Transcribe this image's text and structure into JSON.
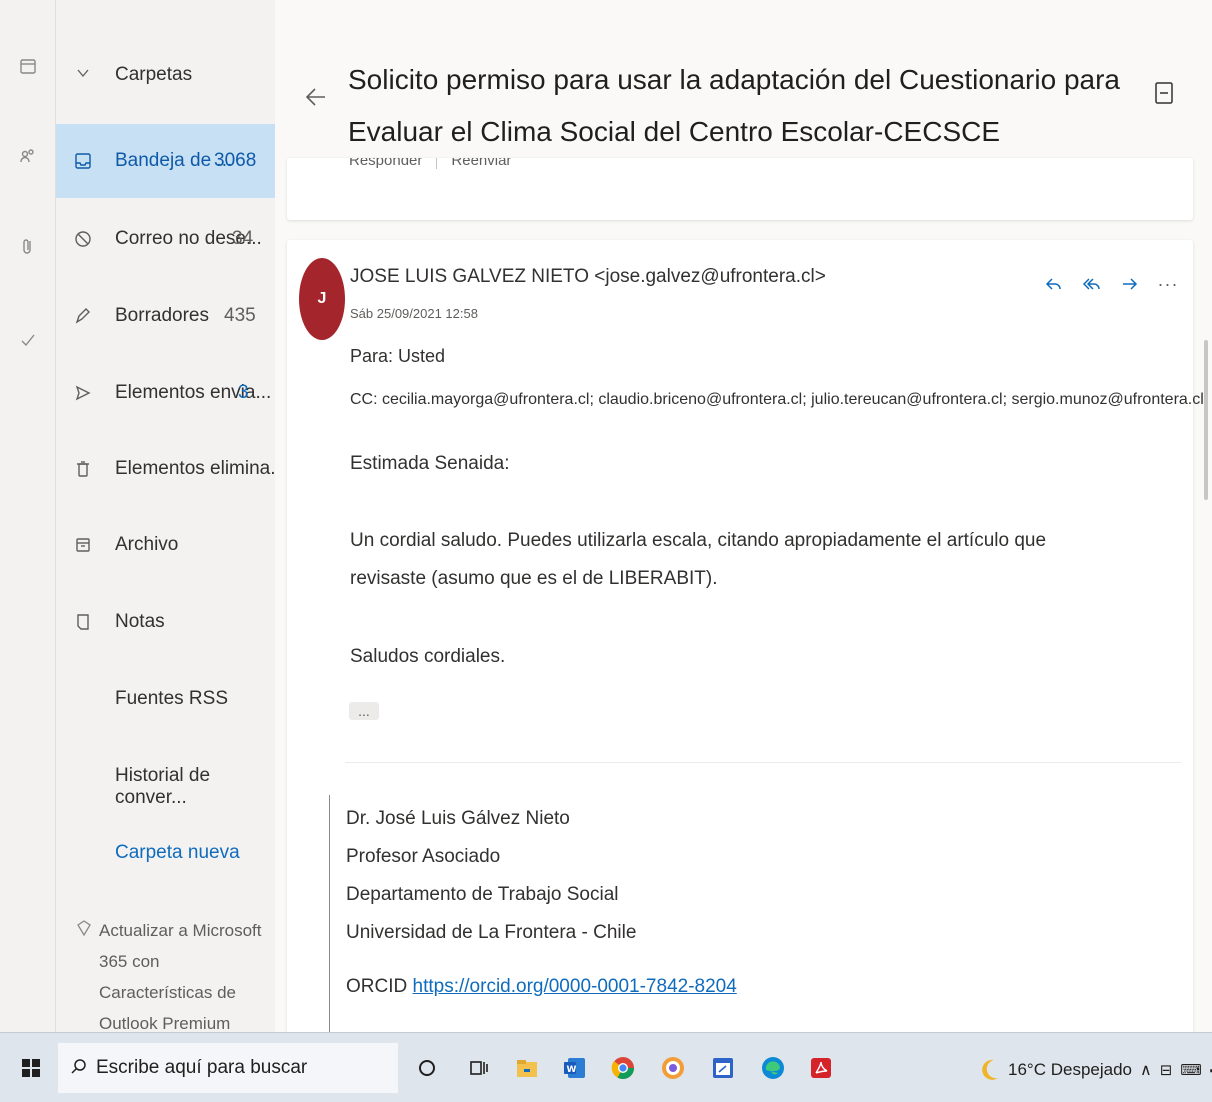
{
  "folders": {
    "header": "Carpetas",
    "items": [
      {
        "label": "Bandeja de ...",
        "count": "3068",
        "icon": "inbox-icon"
      },
      {
        "label": "Correo no dese...",
        "count": "34",
        "icon": "junk-icon"
      },
      {
        "label": "Borradores",
        "count": "435",
        "icon": "pencil-icon"
      },
      {
        "label": "Elementos envia...",
        "count": "3",
        "icon": "send-icon"
      },
      {
        "label": "Elementos elimina...",
        "count": "",
        "icon": "trash-icon"
      },
      {
        "label": "Archivo",
        "count": "",
        "icon": "archive-icon"
      },
      {
        "label": "Notas",
        "count": "",
        "icon": "note-icon"
      }
    ],
    "links": [
      "Fuentes RSS",
      "Historial de conver...",
      "Carpeta nueva"
    ],
    "upgrade": "Actualizar a Microsoft 365 con Características de Outlook Premium"
  },
  "message": {
    "subject": "Solicito permiso para usar la adaptación del Cuestionario para Evaluar el Clima Social del Centro Escolar-CECSCE",
    "prev_actions": [
      "Responder",
      "Reenviar"
    ],
    "avatar_initial": "J",
    "sender": "JOSE LUIS GALVEZ NIETO <jose.galvez@ufrontera.cl>",
    "date": "Sáb 25/09/2021 12:58",
    "to": "Para: Usted",
    "cc": "CC: cecilia.mayorga@ufrontera.cl; claudio.briceno@ufrontera.cl; julio.tereucan@ufrontera.cl; sergio.munoz@ufrontera.cl",
    "greeting": "Estimada Senaida:",
    "paragraph": "Un cordial saludo. Puedes utilizarla escala, citando apropiadamente el artículo que revisaste (asumo que es el de LIBERABIT).",
    "closing": "Saludos cordiales.",
    "ellipsis": "...",
    "signature": {
      "name": "Dr. José Luis Gálvez Nieto",
      "title": "Profesor Asociado",
      "department": "Departamento de Trabajo Social",
      "university": "Universidad de La Frontera - Chile",
      "orcid_label": "ORCID",
      "orcid_link": "https://orcid.org/0000-0001-7842-8204"
    }
  },
  "taskbar": {
    "search_placeholder": "Escribe aquí para buscar",
    "weather": "16°C  Despejado"
  },
  "colors": {
    "accent": "#0f6cbd",
    "active_folder": "#c7e0f4",
    "avatar": "#a4262c"
  }
}
